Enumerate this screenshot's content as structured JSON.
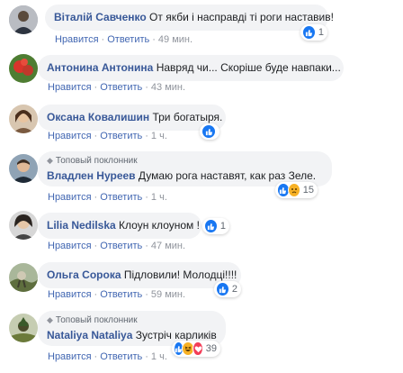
{
  "comments": [
    {
      "author": "Віталій Савченко",
      "text": "От якби і насправді ті роги наставив!",
      "like": "Нравится",
      "reply": "Ответить",
      "time": "49 мин.",
      "reactions_count": "1",
      "avatar_color": "#8a8f99"
    },
    {
      "author": "Антонина Антонина",
      "text": "Навряд чи... Скоріше буде навпаки...",
      "like": "Нравится",
      "reply": "Ответить",
      "time": "43 мин.",
      "avatar_color": "#c0392b"
    },
    {
      "author": "Оксана Ковалишин",
      "text": "Три богатыря.",
      "like": "Нравится",
      "reply": "Ответить",
      "time": "1 ч.",
      "reactions_count": "",
      "avatar_color": "#a67c52"
    },
    {
      "badge": "Топовый поклонник",
      "author": "Владлен Нуреев",
      "text": "Думаю рога наставят, как раз Зеле.",
      "like": "Нравится",
      "reply": "Ответить",
      "time": "1 ч.",
      "reactions_count": "15",
      "avatar_color": "#6d7f8f"
    },
    {
      "author": "Lilia Nedilska",
      "text": "Клоун клоуном !",
      "like": "Нравится",
      "reply": "Ответить",
      "time": "47 мин.",
      "reactions_count": "1",
      "avatar_color": "#3a3a3a"
    },
    {
      "author": "Ольга Сорока",
      "text": "Підловили! Молодці!!!!",
      "like": "Нравится",
      "reply": "Ответить",
      "time": "59 мин.",
      "reactions_count": "2",
      "avatar_color": "#7a8a5a"
    },
    {
      "badge": "Топовый поклонник",
      "author": "Nataliya Nataliya",
      "text": "Зустріч карликів",
      "like": "Нравится",
      "reply": "Ответить",
      "time": "1 ч.",
      "reactions_count": "39",
      "avatar_color": "#5b6b3a"
    }
  ],
  "separator": "·",
  "colors": {
    "author": "#385898",
    "bubble": "#f2f3f5",
    "link": "#4267b2",
    "meta": "#90949c",
    "like_reaction": "#1877f2"
  },
  "icons": {
    "like": "thumbs-up-icon",
    "sad": "sad-face-icon",
    "haha": "laughing-face-icon",
    "love": "heart-icon",
    "badge": "diamond-icon"
  }
}
